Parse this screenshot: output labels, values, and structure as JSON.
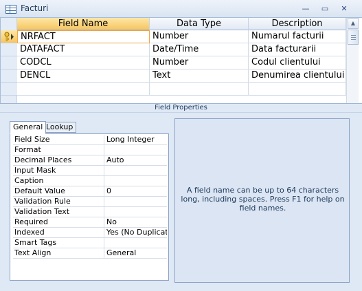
{
  "window": {
    "title": "Facturi",
    "controls": {
      "minimize": "—",
      "maximize": "▭",
      "close": "✕"
    }
  },
  "grid": {
    "columns": [
      "Field Name",
      "Data Type",
      "Description"
    ],
    "rows": [
      {
        "field_name": "NRFACT",
        "data_type": "Number",
        "description": "Numarul facturii",
        "primary_key": true
      },
      {
        "field_name": "DATAFACT",
        "data_type": "Date/Time",
        "description": "Data facturarii"
      },
      {
        "field_name": "CODCL",
        "data_type": "Number",
        "description": "Codul clientului"
      },
      {
        "field_name": "DENCL",
        "data_type": "Text",
        "description": "Denumirea clientului"
      },
      {
        "field_name": "",
        "data_type": "",
        "description": ""
      }
    ],
    "scroll_up_icon": "scroll-up-arrow-icon",
    "primary_key_icon": "key-icon"
  },
  "field_properties": {
    "title": "Field Properties",
    "tabs": [
      "General",
      "Lookup"
    ],
    "active_tab": "General",
    "properties": [
      {
        "name": "Field Size",
        "value": "Long Integer"
      },
      {
        "name": "Format",
        "value": ""
      },
      {
        "name": "Decimal Places",
        "value": "Auto"
      },
      {
        "name": "Input Mask",
        "value": ""
      },
      {
        "name": "Caption",
        "value": ""
      },
      {
        "name": "Default Value",
        "value": "0"
      },
      {
        "name": "Validation Rule",
        "value": ""
      },
      {
        "name": "Validation Text",
        "value": ""
      },
      {
        "name": "Required",
        "value": "No"
      },
      {
        "name": "Indexed",
        "value": "Yes (No Duplicates)"
      },
      {
        "name": "Smart Tags",
        "value": ""
      },
      {
        "name": "Text Align",
        "value": "General"
      }
    ],
    "help_text": "A field name can be up to 64 characters long, including spaces.  Press F1 for help on field names."
  },
  "colors": {
    "accent": "#f7c55f",
    "frame": "#a7bcd8",
    "pane_bg": "#dfe8f5",
    "help_text": "#1e395b"
  }
}
